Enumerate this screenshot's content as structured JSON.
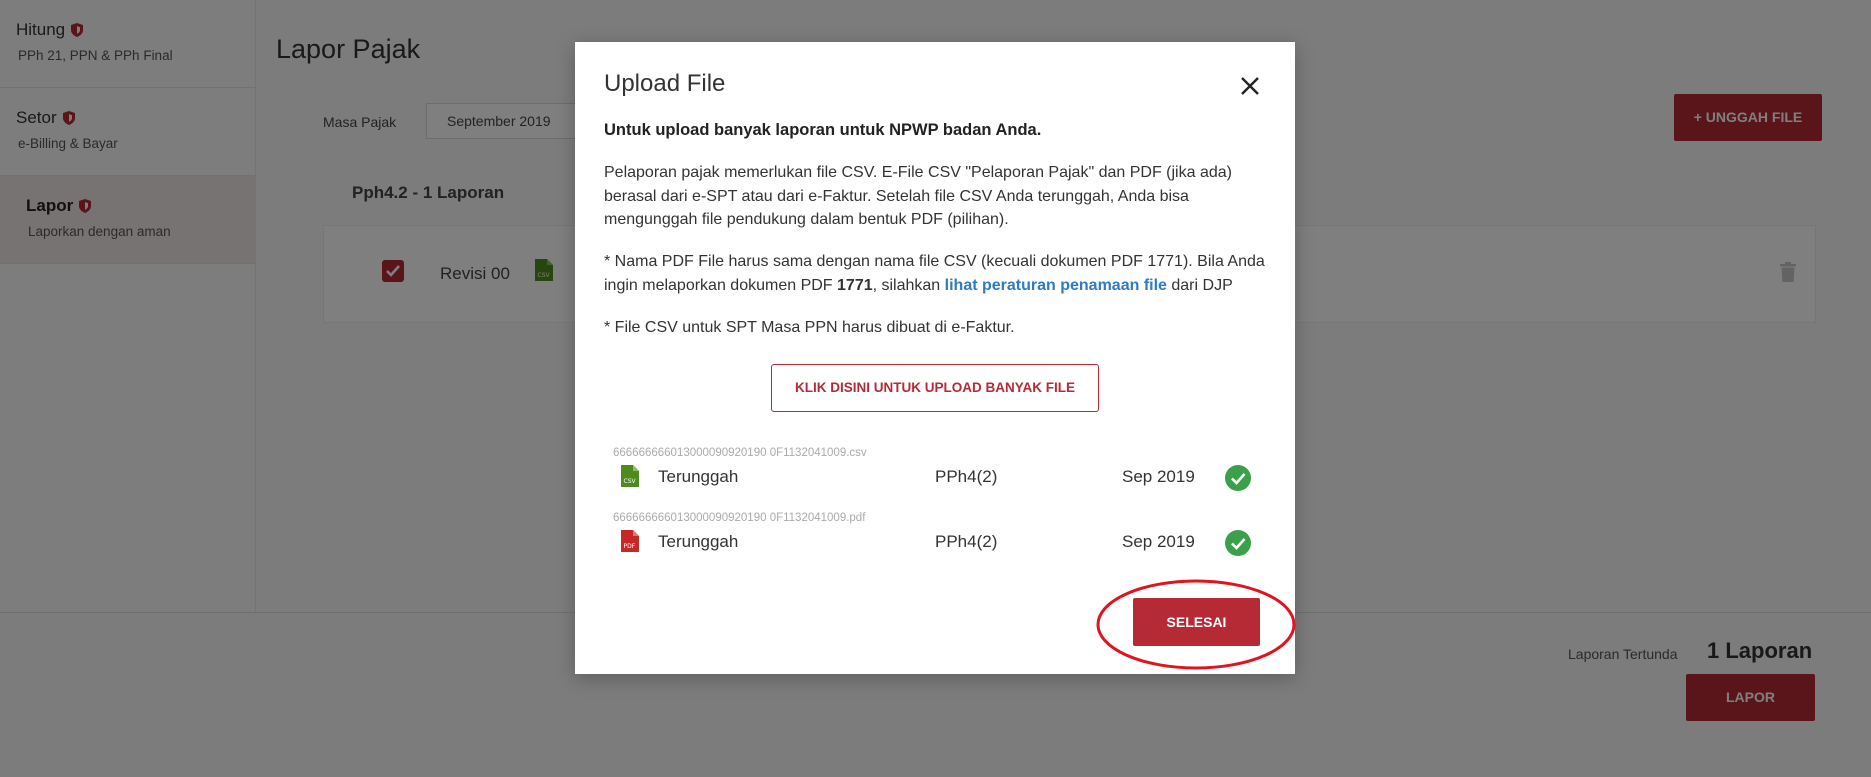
{
  "sidebar": {
    "items": [
      {
        "title": "Hitung",
        "subtitle": "PPh 21, PPN & PPh Final"
      },
      {
        "title": "Setor",
        "subtitle": "e-Billing & Bayar"
      },
      {
        "title": "Lapor",
        "subtitle": "Laporkan dengan aman"
      }
    ]
  },
  "main": {
    "title": "Lapor Pajak",
    "masa_label": "Masa Pajak",
    "masa_value": "September 2019",
    "unggah_label": "+ UNGGAH FILE",
    "group_title": "Pph4.2 - 1 Laporan",
    "report": {
      "revisi": "Revisi 00"
    }
  },
  "footer": {
    "pending_label": "Laporan Tertunda",
    "pending_count": "1 Laporan",
    "lapor_label": "LAPOR"
  },
  "modal": {
    "title": "Upload File",
    "subtitle": "Untuk upload banyak laporan untuk NPWP badan Anda.",
    "para1": "Pelaporan pajak memerlukan file CSV. E-File CSV \"Pelaporan Pajak\" dan PDF (jika ada) berasal dari e-SPT atau dari e-Faktur. Setelah file CSV Anda terunggah, Anda bisa mengunggah file pendukung dalam bentuk PDF (pilihan).",
    "para2_a": "* Nama PDF File harus sama dengan nama file CSV (kecuali dokumen PDF 1771). Bila Anda ingin melaporkan dokumen PDF ",
    "para2_bold": "1771",
    "para2_b": ", silahkan ",
    "para2_link": "lihat peraturan penamaan file",
    "para2_c": " dari DJP",
    "para3": "* File CSV untuk SPT Masa PPN harus dibuat di e-Faktur.",
    "upload_many_label": "KLIK DISINI UNTUK UPLOAD BANYAK FILE",
    "files": [
      {
        "name": "666666666013000090920190 0F1132041009.csv",
        "type": "csv",
        "status": "Terunggah",
        "jenis": "PPh4(2)",
        "masa": "Sep 2019"
      },
      {
        "name": "666666666013000090920190 0F1132041009.pdf",
        "type": "pdf",
        "status": "Terunggah",
        "jenis": "PPh4(2)",
        "masa": "Sep 2019"
      }
    ],
    "selesai_label": "SELESAI"
  },
  "colors": {
    "brand_red": "#b52a34",
    "link_blue": "#2f7bc1",
    "success_green": "#3aa14a",
    "csv_green": "#4f8a1f",
    "pdf_red": "#c62828"
  }
}
